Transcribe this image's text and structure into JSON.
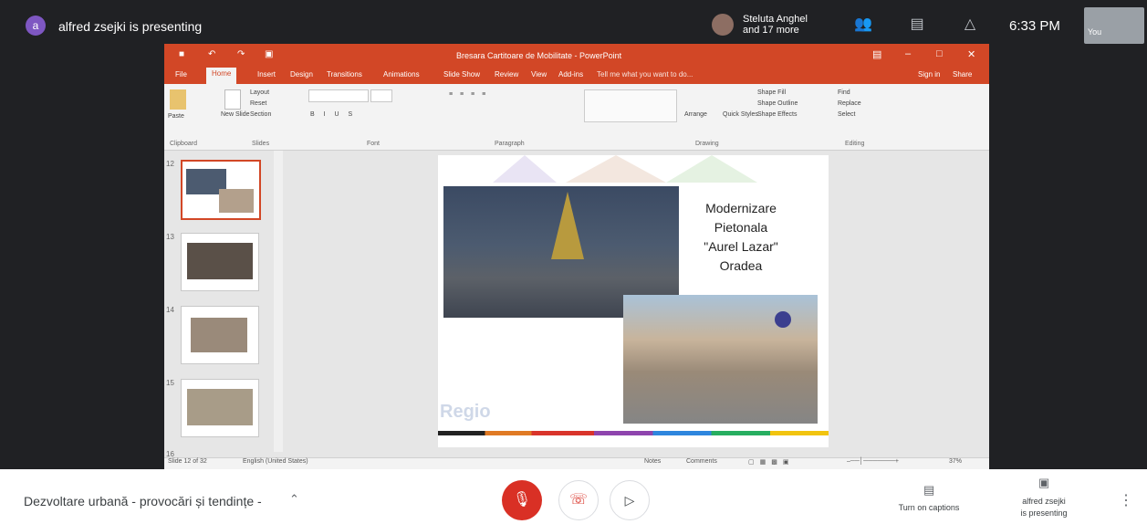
{
  "topbar": {
    "presenter_initial": "a",
    "presenter_text": "alfred zsejki is presenting",
    "participant_name": "Steluta Anghel",
    "participant_more": "and 17 more",
    "time": "6:33 PM",
    "self_label": "You",
    "icons": [
      "people-icon",
      "chat-icon",
      "activities-icon"
    ]
  },
  "powerpoint": {
    "window_title": "Bresara Cartitoare de Mobilitate - PowerPoint",
    "tabs": [
      "File",
      "Home",
      "Insert",
      "Design",
      "Transitions",
      "Animations",
      "Slide Show",
      "Review",
      "View",
      "Add-ins"
    ],
    "tell_me": "Tell me what you want to do...",
    "sign_in": "Sign in",
    "share": "Share",
    "ribbon": {
      "clipboard": "Clipboard",
      "paste": "Paste",
      "slides": "Slides",
      "new_slide": "New Slide",
      "layout": "Layout",
      "reset": "Reset",
      "section": "Section",
      "font": "Font",
      "paragraph": "Paragraph",
      "drawing": "Drawing",
      "arrange": "Arrange",
      "quick_styles": "Quick Styles",
      "shape_fill": "Shape Fill",
      "shape_outline": "Shape Outline",
      "shape_effects": "Shape Effects",
      "editing": "Editing",
      "find": "Find",
      "replace": "Replace",
      "select": "Select"
    },
    "thumbnails": [
      {
        "num": "12"
      },
      {
        "num": "13"
      },
      {
        "num": "14"
      },
      {
        "num": "15"
      },
      {
        "num": "16"
      }
    ],
    "slide": {
      "text_lines": [
        "Modernizare",
        "Pietonala",
        "\"Aurel Lazar\"",
        "Oradea"
      ],
      "logo": "Regio"
    },
    "status": {
      "slide_info": "Slide 12 of 32",
      "language": "English (United States)",
      "notes": "Notes",
      "comments": "Comments",
      "zoom": "37%"
    }
  },
  "bottombar": {
    "meeting_title": "Dezvoltare urbană - provocări și tendințe -",
    "captions_label": "Turn on captions",
    "present_label_1": "alfred zsejki",
    "present_label_2": "is presenting"
  }
}
